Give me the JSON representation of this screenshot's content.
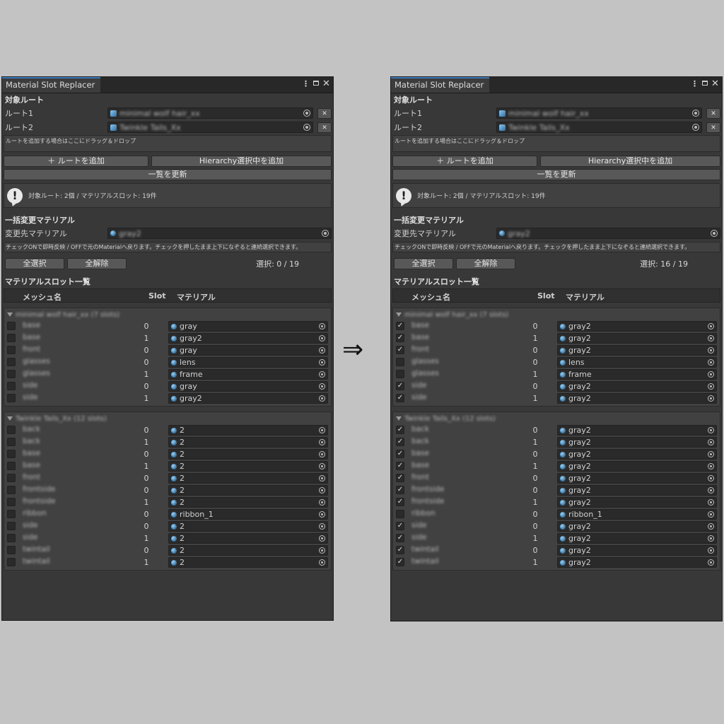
{
  "panels": [
    {
      "title": "Material Slot Replacer",
      "target_root_section": "対象ルート",
      "roots": [
        {
          "label": "ルート1",
          "value": "minimal wolf hair_xx"
        },
        {
          "label": "ルート2",
          "value": "Twinkle Tails_Xx"
        }
      ],
      "drop_hint": "ルートを追加する場合はここにドラッグ＆ドロップ",
      "add_root_button": "＋ ルートを追加",
      "add_hierarchy_button": "Hierarchy選択中を追加",
      "refresh_button": "一覧を更新",
      "info_text": "対象ルート: 2個 / マテリアルスロット: 19件",
      "bulk_section": "一括変更マテリアル",
      "target_material_label": "変更先マテリアル",
      "target_material_value": "gray2",
      "toggle_hint": "チェックONで即時反映 / OFFで元のMaterialへ戻ります。チェックを押したまま上下になぞると連続選択できます。",
      "select_all_button": "全選択",
      "deselect_all_button": "全解除",
      "selection_count": "選択: 0 / 19",
      "list_section": "マテリアルスロット一覧",
      "col_mesh": "メッシュ名",
      "col_slot": "Slot",
      "col_material": "マテリアル",
      "groups": [
        {
          "name": "minimal wolf hair_xx (7 slots)",
          "rows": [
            {
              "mesh": "base",
              "slot": "0",
              "material": "gray",
              "checked": false
            },
            {
              "mesh": "base",
              "slot": "1",
              "material": "gray2",
              "checked": false
            },
            {
              "mesh": "front",
              "slot": "0",
              "material": "gray",
              "checked": false
            },
            {
              "mesh": "glasses",
              "slot": "0",
              "material": "lens",
              "checked": false
            },
            {
              "mesh": "glasses",
              "slot": "1",
              "material": "frame",
              "checked": false
            },
            {
              "mesh": "side",
              "slot": "0",
              "material": "gray",
              "checked": false
            },
            {
              "mesh": "side",
              "slot": "1",
              "material": "gray2",
              "checked": false
            }
          ]
        },
        {
          "name": "Twinkle Tails_Xx (12 slots)",
          "rows": [
            {
              "mesh": "back",
              "slot": "0",
              "material": "2",
              "checked": false
            },
            {
              "mesh": "back",
              "slot": "1",
              "material": "2",
              "checked": false
            },
            {
              "mesh": "base",
              "slot": "0",
              "material": "2",
              "checked": false
            },
            {
              "mesh": "base",
              "slot": "1",
              "material": "2",
              "checked": false
            },
            {
              "mesh": "front",
              "slot": "0",
              "material": "2",
              "checked": false
            },
            {
              "mesh": "frontside",
              "slot": "0",
              "material": "2",
              "checked": false
            },
            {
              "mesh": "frontside",
              "slot": "1",
              "material": "2",
              "checked": false
            },
            {
              "mesh": "ribbon",
              "slot": "0",
              "material": "ribbon_1",
              "checked": false
            },
            {
              "mesh": "side",
              "slot": "0",
              "material": "2",
              "checked": false
            },
            {
              "mesh": "side",
              "slot": "1",
              "material": "2",
              "checked": false
            },
            {
              "mesh": "twintail",
              "slot": "0",
              "material": "2",
              "checked": false
            },
            {
              "mesh": "twintail",
              "slot": "1",
              "material": "2",
              "checked": false
            }
          ]
        }
      ]
    },
    {
      "title": "Material Slot Replacer",
      "target_root_section": "対象ルート",
      "roots": [
        {
          "label": "ルート1",
          "value": "minimal wolf hair_xx"
        },
        {
          "label": "ルート2",
          "value": "Twinkle Tails_Xx"
        }
      ],
      "drop_hint": "ルートを追加する場合はここにドラッグ＆ドロップ",
      "add_root_button": "＋ ルートを追加",
      "add_hierarchy_button": "Hierarchy選択中を追加",
      "refresh_button": "一覧を更新",
      "info_text": "対象ルート: 2個 / マテリアルスロット: 19件",
      "bulk_section": "一括変更マテリアル",
      "target_material_label": "変更先マテリアル",
      "target_material_value": "gray2",
      "toggle_hint": "チェックONで即時反映 / OFFで元のMaterialへ戻ります。チェックを押したまま上下になぞると連続選択できます。",
      "select_all_button": "全選択",
      "deselect_all_button": "全解除",
      "selection_count": "選択: 16 / 19",
      "list_section": "マテリアルスロット一覧",
      "col_mesh": "メッシュ名",
      "col_slot": "Slot",
      "col_material": "マテリアル",
      "groups": [
        {
          "name": "minimal wolf hair_xx (7 slots)",
          "rows": [
            {
              "mesh": "base",
              "slot": "0",
              "material": "gray2",
              "checked": true
            },
            {
              "mesh": "base",
              "slot": "1",
              "material": "gray2",
              "checked": true
            },
            {
              "mesh": "front",
              "slot": "0",
              "material": "gray2",
              "checked": true
            },
            {
              "mesh": "glasses",
              "slot": "0",
              "material": "lens",
              "checked": false
            },
            {
              "mesh": "glasses",
              "slot": "1",
              "material": "frame",
              "checked": false
            },
            {
              "mesh": "side",
              "slot": "0",
              "material": "gray2",
              "checked": true
            },
            {
              "mesh": "side",
              "slot": "1",
              "material": "gray2",
              "checked": true
            }
          ]
        },
        {
          "name": "Twinkle Tails_Xx (12 slots)",
          "rows": [
            {
              "mesh": "back",
              "slot": "0",
              "material": "gray2",
              "checked": true
            },
            {
              "mesh": "back",
              "slot": "1",
              "material": "gray2",
              "checked": true
            },
            {
              "mesh": "base",
              "slot": "0",
              "material": "gray2",
              "checked": true
            },
            {
              "mesh": "base",
              "slot": "1",
              "material": "gray2",
              "checked": true
            },
            {
              "mesh": "front",
              "slot": "0",
              "material": "gray2",
              "checked": true
            },
            {
              "mesh": "frontside",
              "slot": "0",
              "material": "gray2",
              "checked": true
            },
            {
              "mesh": "frontside",
              "slot": "1",
              "material": "gray2",
              "checked": true
            },
            {
              "mesh": "ribbon",
              "slot": "0",
              "material": "ribbon_1",
              "checked": false
            },
            {
              "mesh": "side",
              "slot": "0",
              "material": "gray2",
              "checked": true
            },
            {
              "mesh": "side",
              "slot": "1",
              "material": "gray2",
              "checked": true
            },
            {
              "mesh": "twintail",
              "slot": "0",
              "material": "gray2",
              "checked": true
            },
            {
              "mesh": "twintail",
              "slot": "1",
              "material": "gray2",
              "checked": true
            }
          ]
        }
      ]
    }
  ],
  "arrow": "⇒",
  "colors": {
    "accent": "#3a79bb",
    "background": "#c3c3c3",
    "panel": "#383838"
  }
}
